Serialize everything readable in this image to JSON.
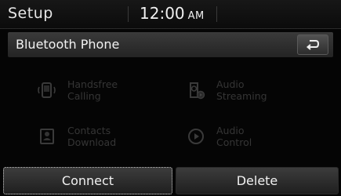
{
  "topbar": {
    "title": "Setup",
    "time": "12:00",
    "ampm": "AM"
  },
  "header": {
    "title": "Bluetooth Phone",
    "back_icon": "back-arrow-icon"
  },
  "menu": [
    {
      "label": "Handsfree\nCalling",
      "icon": "handsfree-phone-icon",
      "enabled": false
    },
    {
      "label": "Audio\nStreaming",
      "icon": "audio-streaming-icon",
      "enabled": false
    },
    {
      "label": "Contacts\nDownload",
      "icon": "contacts-download-icon",
      "enabled": false
    },
    {
      "label": "Audio\nControl",
      "icon": "audio-control-icon",
      "enabled": false
    }
  ],
  "buttons": {
    "connect": "Connect",
    "delete": "Delete"
  },
  "colors": {
    "background": "#050505",
    "disabled_text": "#353535",
    "focus_outline": "#cfcfcf"
  }
}
